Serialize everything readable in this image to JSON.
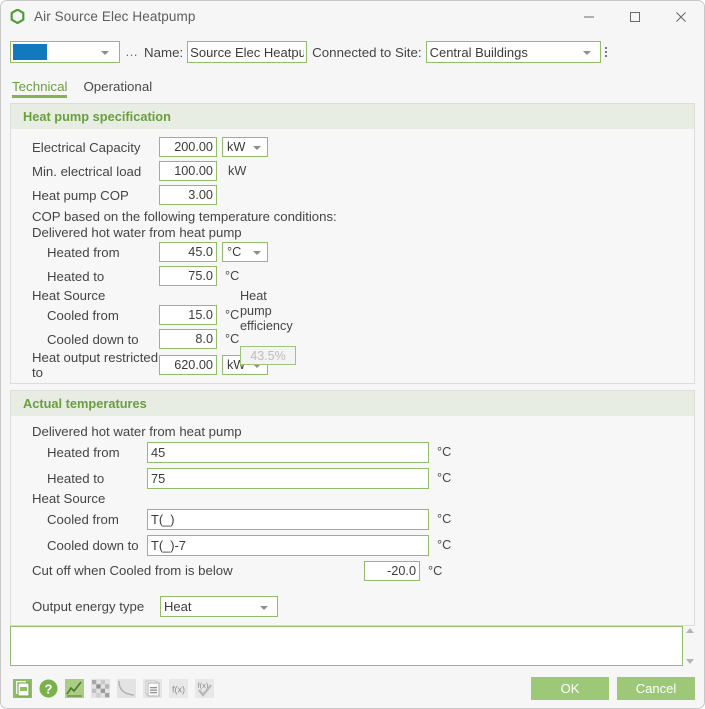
{
  "window": {
    "title": "Air Source Elec Heatpump",
    "app_icon": "hexagon-ring-icon",
    "controls": {
      "minimize": "minimize-icon",
      "maximize": "maximize-icon",
      "close": "close-icon"
    }
  },
  "header": {
    "colour_swatch_hex": "#1379BE",
    "colour_more_label": "…",
    "name_label": "Name:",
    "name_value": "Source Elec Heatpump",
    "site_label": "Connected to Site:",
    "site_value": "Central Buildings"
  },
  "tabs": [
    {
      "label": "Technical",
      "active": true
    },
    {
      "label": "Operational",
      "active": false
    }
  ],
  "spec_panel": {
    "title": "Heat pump specification",
    "rows": {
      "electrical_capacity": {
        "label": "Electrical Capacity",
        "value": "200.00",
        "unit": "kW"
      },
      "min_electrical_load": {
        "label": "Min. electrical load",
        "value": "100.00",
        "unit": "kW"
      },
      "heat_pump_cop": {
        "label": "Heat pump COP",
        "value": "3.00"
      }
    },
    "cop_note": "COP based on the following temperature conditions:",
    "delivered_note": "Delivered hot water from heat pump",
    "heated_from": {
      "label": "Heated from",
      "value": "45.0",
      "unit": "°C"
    },
    "heated_to": {
      "label": "Heated to",
      "value": "75.0",
      "unit": "°C"
    },
    "heat_source_note": "Heat Source",
    "cooled_from": {
      "label": "Cooled from",
      "value": "15.0",
      "unit": "°C"
    },
    "cooled_down_to": {
      "label": "Cooled down to",
      "value": "8.0",
      "unit": "°C"
    },
    "heat_output": {
      "label": "Heat output restricted to",
      "value": "620.00",
      "unit": "kW"
    },
    "efficiency": {
      "label": "Heat pump efficiency",
      "value": "43.5%"
    }
  },
  "actual_panel": {
    "title": "Actual temperatures",
    "delivered_note": "Delivered hot water from heat pump",
    "heated_from": {
      "label": "Heated from",
      "value": "45",
      "unit": "°C"
    },
    "heated_to": {
      "label": "Heated to",
      "value": "75",
      "unit": "°C"
    },
    "heat_source_note": "Heat Source",
    "cooled_from": {
      "label": "Cooled from",
      "value": "T(_)",
      "unit": "°C"
    },
    "cooled_down_to": {
      "label": "Cooled down to",
      "value": "T(_)-7",
      "unit": "°C"
    },
    "cut_off": {
      "label": "Cut off when Cooled from is below",
      "value": "-20.0",
      "unit": "°C"
    },
    "output_energy_type": {
      "label": "Output energy type",
      "value": "Heat"
    }
  },
  "notes": {
    "value": "",
    "scroll_up": "scroll-up-icon",
    "scroll_down": "scroll-down-icon"
  },
  "toolbar": {
    "icons": [
      "document-icon",
      "help-icon",
      "chart-icon",
      "grid-icon",
      "curve-icon",
      "report-icon",
      "function-icon",
      "function-check-icon"
    ]
  },
  "footer": {
    "ok_label": "OK",
    "cancel_label": "Cancel"
  },
  "colors": {
    "accent_green": "#6A9E3F",
    "field_border": "#90BC6B",
    "button_green": "#9CC878",
    "panel_header": "#E8EDE4"
  }
}
